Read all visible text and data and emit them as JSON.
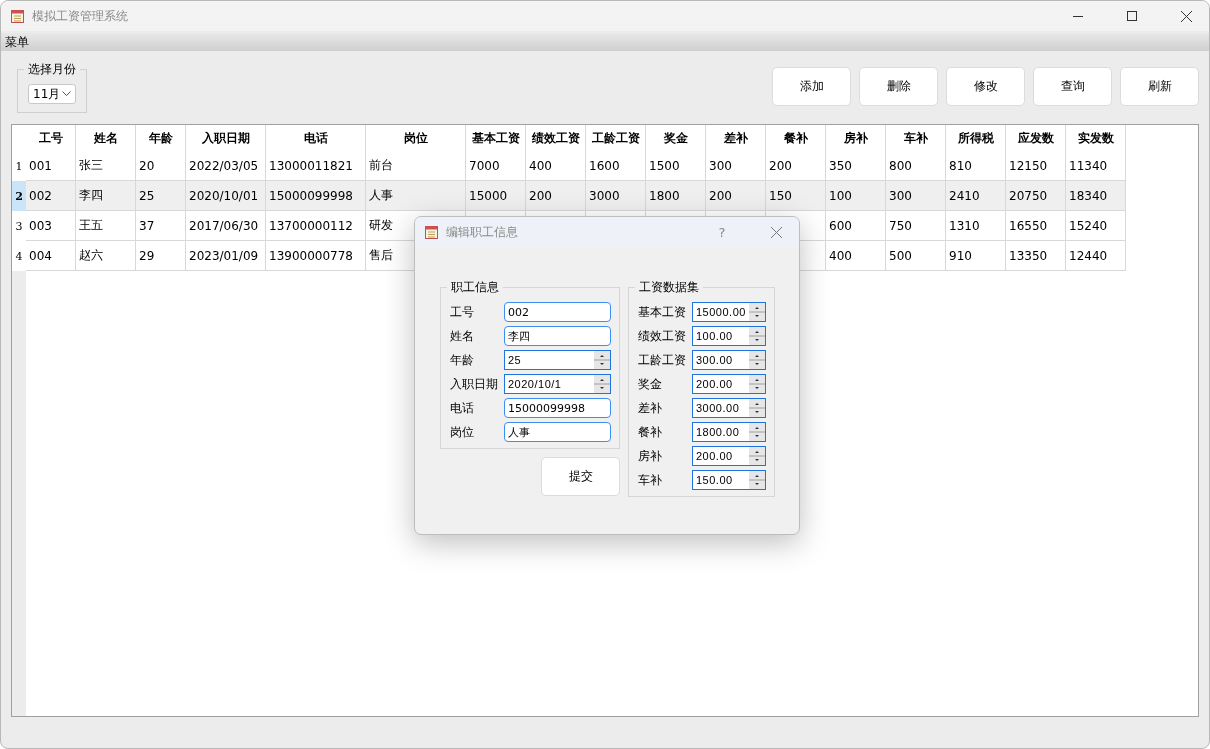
{
  "window": {
    "title": "模拟工资管理系统"
  },
  "menu_bar": {
    "items": [
      "菜单"
    ]
  },
  "month_selector": {
    "label": "选择月份",
    "value": "11月"
  },
  "toolbar": {
    "buttons": [
      "添加",
      "删除",
      "修改",
      "查询",
      "刷新"
    ]
  },
  "table": {
    "columns": [
      "工号",
      "姓名",
      "年龄",
      "入职日期",
      "电话",
      "岗位",
      "基本工资",
      "绩效工资",
      "工龄工资",
      "奖金",
      "差补",
      "餐补",
      "房补",
      "车补",
      "所得税",
      "应发数",
      "实发数"
    ],
    "rows": [
      {
        "number": "1",
        "selected": false,
        "cells": [
          "001",
          "张三",
          "20",
          "2022/03/05",
          "13000011821",
          "前台",
          "7000",
          "400",
          "1600",
          "1500",
          "300",
          "200",
          "350",
          "800",
          "810",
          "12150",
          "11340"
        ]
      },
      {
        "number": "2",
        "selected": true,
        "cells": [
          "002",
          "李四",
          "25",
          "2020/10/01",
          "15000099998",
          "人事",
          "15000",
          "200",
          "3000",
          "1800",
          "200",
          "150",
          "100",
          "300",
          "2410",
          "20750",
          "18340"
        ]
      },
      {
        "number": "3",
        "selected": false,
        "cells": [
          "003",
          "王五",
          "37",
          "2017/06/30",
          "13700000112",
          "研发",
          null,
          null,
          null,
          null,
          null,
          null,
          "600",
          "750",
          "1310",
          "16550",
          "15240"
        ]
      },
      {
        "number": "4",
        "selected": false,
        "cells": [
          "004",
          "赵六",
          "29",
          "2023/01/09",
          "13900000778",
          "售后",
          null,
          null,
          null,
          null,
          null,
          null,
          "400",
          "500",
          "910",
          "13350",
          "12440"
        ]
      }
    ]
  },
  "dialog": {
    "title": "编辑职工信息",
    "help": "?",
    "employee_group": {
      "title": "职工信息",
      "fields": [
        {
          "label": "工号",
          "value": "002",
          "kind": "text"
        },
        {
          "label": "姓名",
          "value": "李四",
          "kind": "text"
        },
        {
          "label": "年龄",
          "value": "25",
          "kind": "spin"
        },
        {
          "label": "入职日期",
          "value": "2020/10/1",
          "kind": "spin"
        },
        {
          "label": "电话",
          "value": "15000099998",
          "kind": "text"
        },
        {
          "label": "岗位",
          "value": "人事",
          "kind": "text"
        }
      ]
    },
    "submit_button": "提交",
    "salary_group": {
      "title": "工资数据集",
      "fields": [
        {
          "label": "基本工资",
          "value": "15000.00"
        },
        {
          "label": "绩效工资",
          "value": "100.00"
        },
        {
          "label": "工龄工资",
          "value": "300.00"
        },
        {
          "label": "奖金",
          "value": "200.00"
        },
        {
          "label": "差补",
          "value": "3000.00"
        },
        {
          "label": "餐补",
          "value": "1800.00"
        },
        {
          "label": "房补",
          "value": "200.00"
        },
        {
          "label": "车补",
          "value": "150.00"
        }
      ]
    }
  }
}
